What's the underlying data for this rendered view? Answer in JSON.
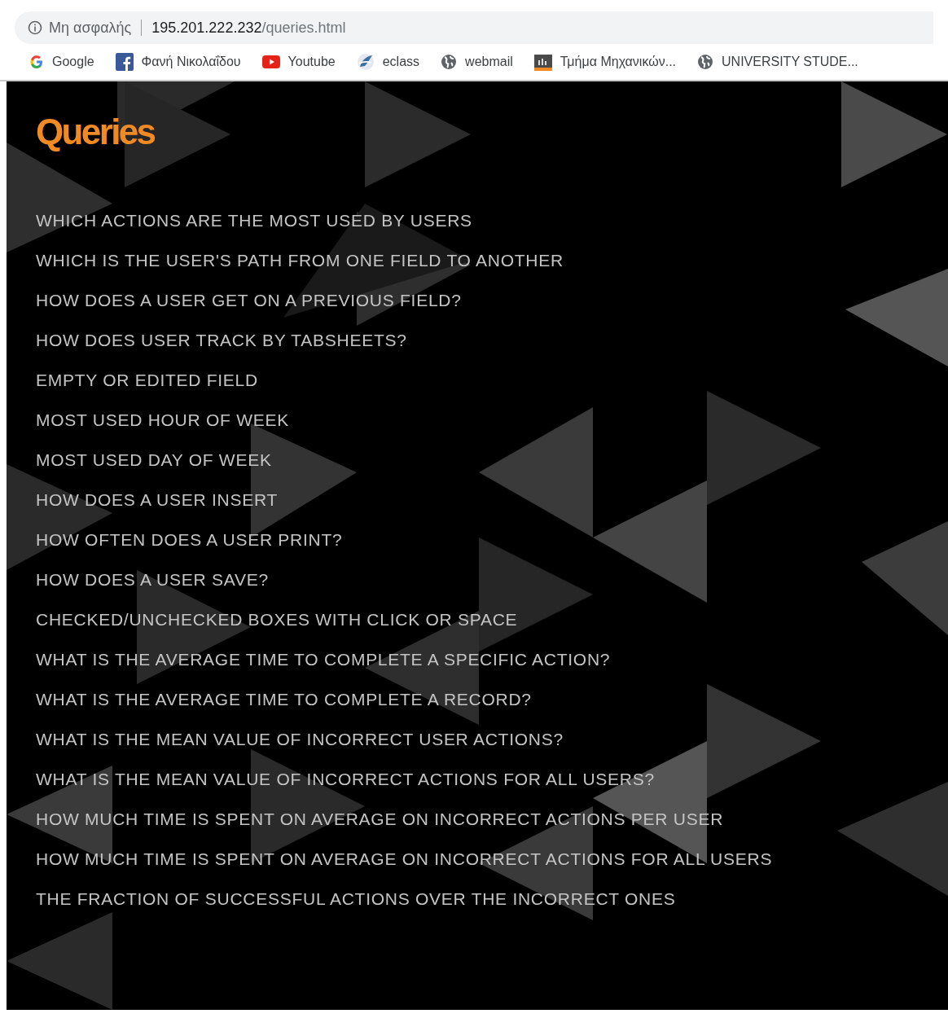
{
  "address_bar": {
    "security_label": "Μη ασφαλής",
    "url_host": "195.201.222.232",
    "url_path": "/queries.html"
  },
  "bookmarks": [
    {
      "label": "Google",
      "kind": "google"
    },
    {
      "label": "Φανή Νικολαΐδου",
      "kind": "facebook"
    },
    {
      "label": "Youtube",
      "kind": "youtube"
    },
    {
      "label": "eclass",
      "kind": "eclass"
    },
    {
      "label": "webmail",
      "kind": "globe"
    },
    {
      "label": "Τμήμα Μηχανικών...",
      "kind": "chart"
    },
    {
      "label": "UNIVERSITY STUDE...",
      "kind": "globe"
    }
  ],
  "page": {
    "title": "Queries",
    "queries": [
      "WHICH ACTIONS ARE THE MOST USED BY USERS",
      "WHICH IS THE USER'S PATH FROM ONE FIELD TO ANOTHER",
      "HOW DOES A USER GET ON A PREVIOUS FIELD?",
      "HOW DOES USER TRACK BY TABSHEETS?",
      "EMPTY OR EDITED FIELD",
      "MOST USED HOUR OF WEEK",
      "MOST USED DAY OF WEEK",
      "HOW DOES A USER INSERT",
      "HOW OFTEN DOES A USER PRINT?",
      "HOW DOES A USER SAVE?",
      "CHECKED/UNCHECKED BOXES WITH CLICK OR SPACE",
      "WHAT IS THE AVERAGE TIME TO COMPLETE A SPECIFIC ACTION?",
      "WHAT IS THE AVERAGE TIME TO COMPLETE A RECORD?",
      "WHAT IS THE MEAN VALUE OF INCORRECT USER ACTIONS?",
      "WHAT IS THE MEAN VALUE OF INCORRECT ACTIONS FOR ALL USERS?",
      "HOW MUCH TIME IS SPENT ON AVERAGE ON INCORRECT ACTIONS PER USER",
      "HOW MUCH TIME IS SPENT ON AVERAGE ON INCORRECT ACTIONS FOR ALL USERS",
      "THE FRACTION OF SUCCESSFUL ACTIONS OVER THE INCORRECT ONES"
    ]
  }
}
